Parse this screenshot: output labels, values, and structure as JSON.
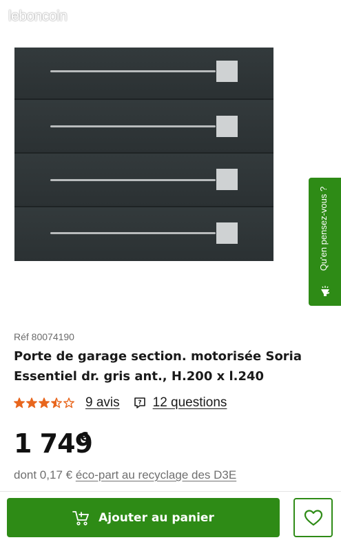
{
  "watermark": "leboncoin",
  "feedback": {
    "label": "Qu'en pensez-vous ?",
    "icon": "megaphone-icon"
  },
  "product": {
    "ref": "Réf 80074190",
    "title": "Porte de garage section. motorisée Soria Essentiel dr. gris ant., H.200 x l.240",
    "rating": 3.5,
    "rating_max": 5,
    "reviews_label": "9 avis",
    "questions_label": "12 questions",
    "price": "1 749",
    "currency": "€",
    "ecopart_prefix": "dont 0,17 € ",
    "ecopart_link": "éco-part au recyclage des D3E"
  },
  "actions": {
    "add_to_cart_label": "Ajouter au panier",
    "cart_icon": "cart-plus-icon",
    "favorite_icon": "heart-icon"
  },
  "colors": {
    "brand_green": "#2e8b16",
    "star_orange": "#e8661d"
  }
}
